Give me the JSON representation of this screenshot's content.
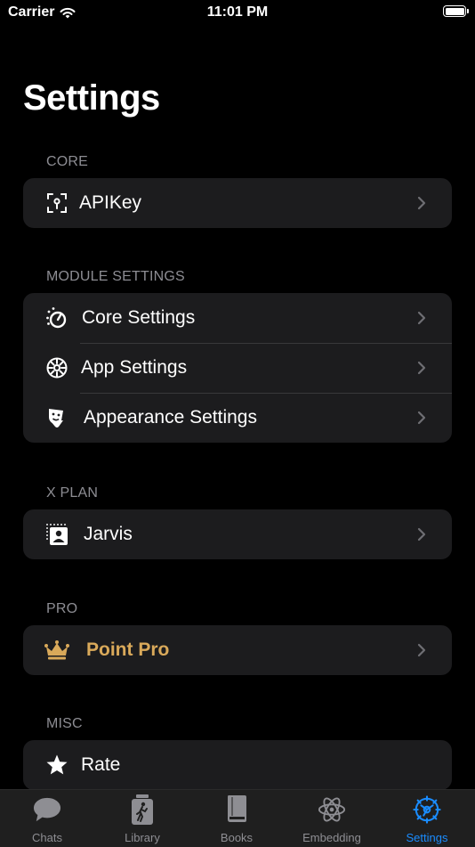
{
  "status_bar": {
    "carrier": "Carrier",
    "time": "11:01 PM"
  },
  "title": "Settings",
  "sections": {
    "core": {
      "header": "CORE",
      "items": [
        {
          "label": "APIKey",
          "icon": "key-icon"
        }
      ]
    },
    "module": {
      "header": "MODULE SETTINGS",
      "items": [
        {
          "label": "Core Settings",
          "icon": "dial-icon"
        },
        {
          "label": "App Settings",
          "icon": "gear-icon"
        },
        {
          "label": "Appearance Settings",
          "icon": "theater-masks-icon"
        }
      ]
    },
    "xplan": {
      "header": "X PLAN",
      "items": [
        {
          "label": "Jarvis",
          "icon": "person-frame-icon"
        }
      ]
    },
    "pro": {
      "header": "PRO",
      "items": [
        {
          "label": "Point Pro",
          "icon": "crown-icon"
        }
      ]
    },
    "misc": {
      "header": "MISC",
      "items": [
        {
          "label": "Rate",
          "icon": "star-icon"
        }
      ]
    }
  },
  "tab_bar": {
    "tabs": [
      {
        "label": "Chats",
        "icon": "chat-bubble-icon",
        "active": false
      },
      {
        "label": "Library",
        "icon": "library-icon",
        "active": false
      },
      {
        "label": "Books",
        "icon": "book-icon",
        "active": false
      },
      {
        "label": "Embedding",
        "icon": "atom-icon",
        "active": false
      },
      {
        "label": "Settings",
        "icon": "gear-icon",
        "active": true
      }
    ]
  },
  "colors": {
    "background": "#000000",
    "group": "#1c1c1e",
    "section_header": "#8d8d93",
    "pro_accent": "#d9a95a",
    "active_tab": "#1a8cff",
    "inactive_tab": "#8e8e93"
  }
}
